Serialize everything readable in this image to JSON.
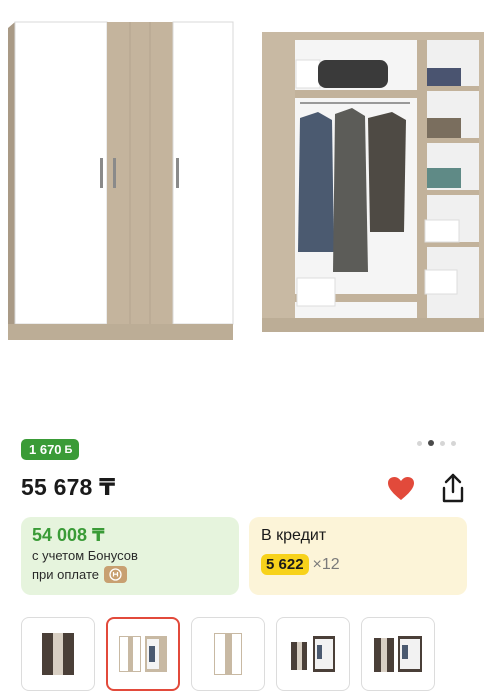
{
  "product": {
    "bonus_badge": "1 670",
    "bonus_icon": "Б",
    "price": "55 678 ₸",
    "favorite_icon": "heart-icon",
    "share_icon": "share-icon"
  },
  "bonus_card": {
    "amount": "54 008 ₸",
    "line1": "с учетом Бонусов",
    "line2": "при оплате"
  },
  "credit_card": {
    "title": "В кредит",
    "monthly": "5 622",
    "multiplier": "×12"
  },
  "gallery": {
    "dots_count": 4,
    "active_dot": 1,
    "selected_thumb": 1,
    "thumbs": [
      "thumb-1",
      "thumb-2",
      "thumb-3",
      "thumb-4",
      "thumb-5"
    ]
  },
  "colors": {
    "green": "#3a9b37",
    "red": "#e24a3b",
    "yellow": "#f7d21b"
  }
}
